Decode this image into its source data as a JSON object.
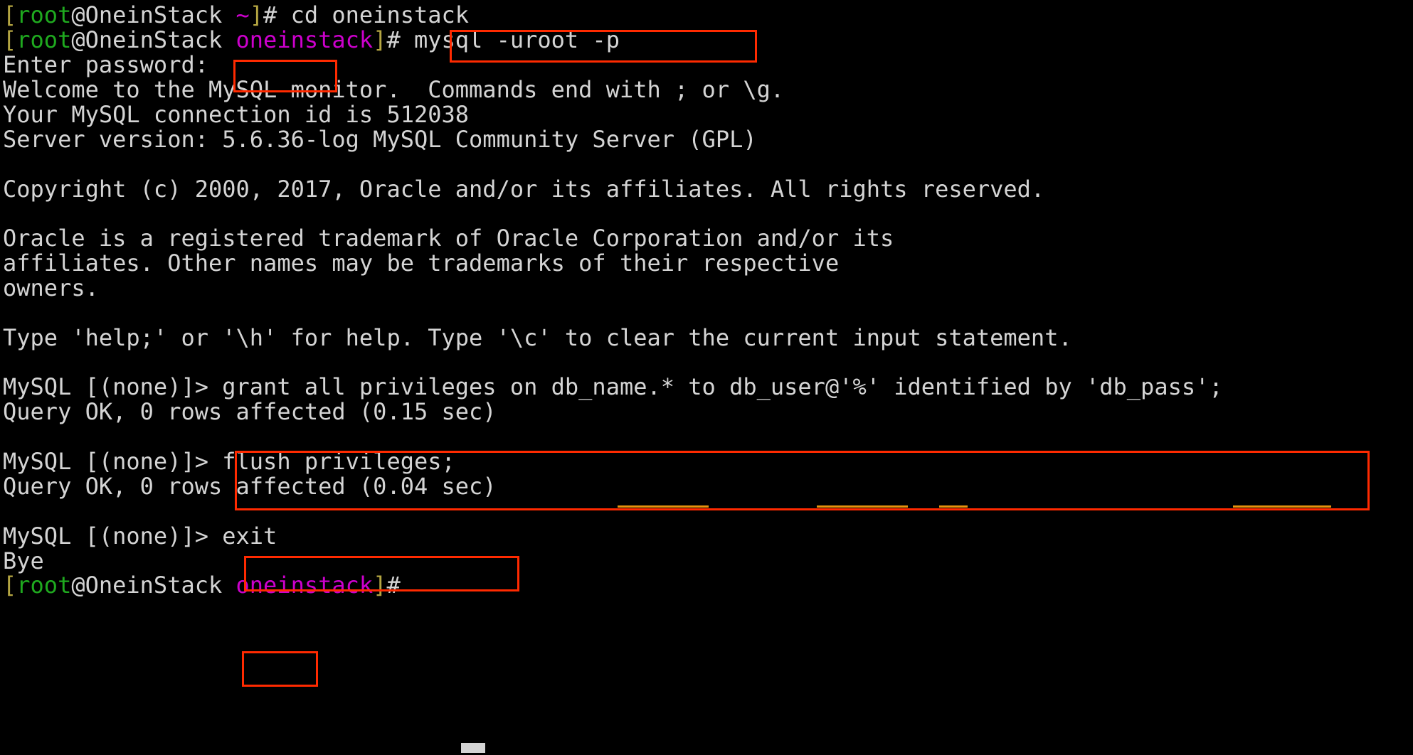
{
  "terminal": {
    "background_color": "#000000",
    "foreground_color": "#d4d4d4",
    "annotation_color": "#ff2a00",
    "underline_color": "#e8920c",
    "prompt_colors": {
      "bracket": "#b5a642",
      "user": "#1fa91f",
      "host": "#d4d4d4",
      "cwd": "#cc00cc"
    },
    "font_size_px": 32,
    "line_height_px": 43.6
  },
  "lines": {
    "l1": {
      "bracket_open": "[",
      "user": "root",
      "host": "@OneinStack",
      "space": " ",
      "cwd": "~",
      "bracket_close": "]",
      "hash": "# ",
      "command": "cd oneinstack"
    },
    "l2": {
      "bracket_open": "[",
      "user": "root",
      "host": "@OneinStack",
      "space": " ",
      "cwd": "oneinstack",
      "bracket_close": "]",
      "hash": "# ",
      "command": "mysql -uroot -p"
    },
    "l3": "Enter password:",
    "l4": "Welcome to the MySQL monitor.  Commands end with ; or \\g.",
    "l5": "Your MySQL connection id is 512038",
    "l6": "Server version: 5.6.36-log MySQL Community Server (GPL)",
    "l7": "",
    "l8": "Copyright (c) 2000, 2017, Oracle and/or its affiliates. All rights reserved.",
    "l9": "",
    "l10": "Oracle is a registered trademark of Oracle Corporation and/or its",
    "l11": "affiliates. Other names may be trademarks of their respective",
    "l12": "owners.",
    "l13": "",
    "l14": "Type 'help;' or '\\h' for help. Type '\\c' to clear the current input statement.",
    "l15": "",
    "l16": {
      "prompt": "MySQL [(none)]> ",
      "command": "grant all privileges on db_name.* to db_user@'%' identified by 'db_pass';"
    },
    "l17": "Query OK, 0 rows affected (0.15 sec)",
    "l18": "",
    "l19": {
      "prompt": "MySQL [(none)]> ",
      "command": "flush privileges;"
    },
    "l20": "Query OK, 0 rows affected (0.04 sec)",
    "l21": "",
    "l22": {
      "prompt": "MySQL [(none)]> ",
      "command": "exit"
    },
    "l23": "Bye",
    "l24": {
      "bracket_open": "[",
      "user": "root",
      "host": "@OneinStack",
      "space": " ",
      "cwd": "oneinstack",
      "bracket_close": "]",
      "hash": "#"
    }
  }
}
